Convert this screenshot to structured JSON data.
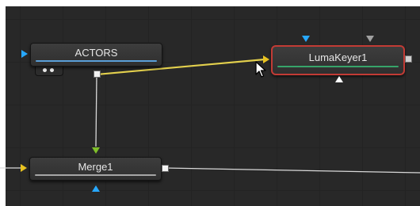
{
  "nodes": {
    "actors": {
      "label": "ACTORS"
    },
    "lumakeyer": {
      "label": "LumaKeyer1"
    },
    "merge": {
      "label": "Merge1"
    }
  },
  "colors": {
    "background_port": "#e8c220",
    "foreground_port": "#27a8ff",
    "effect_mask_port": "#ffffff",
    "merge_foreground_port": "#7fbf2a",
    "selected_outline": "#c23b35",
    "wire_selected": "#e3d04d",
    "wire_default": "#d9d9d9"
  },
  "icons": [
    "view-indicator-dots-icon",
    "mouse-pointer-icon"
  ]
}
